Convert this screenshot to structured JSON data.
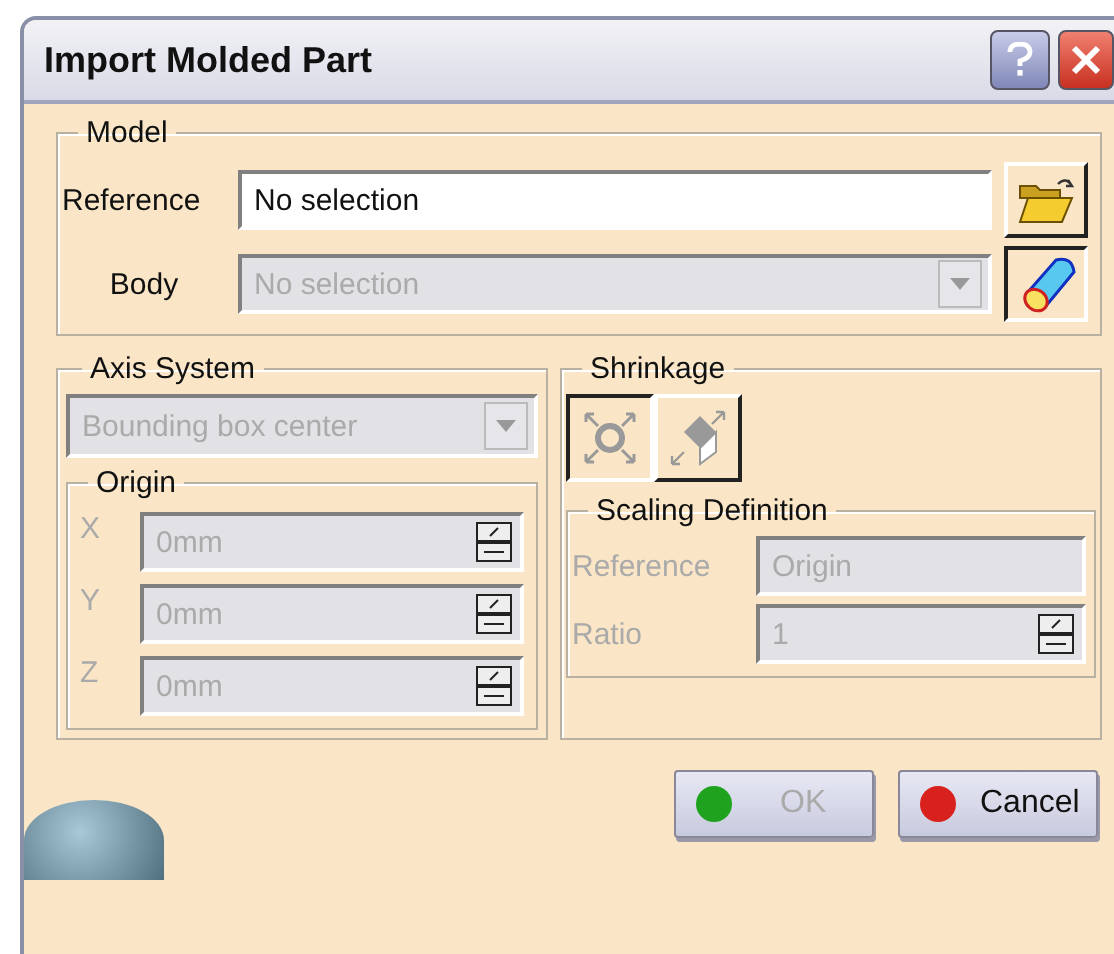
{
  "window": {
    "title": "Import Molded Part"
  },
  "model": {
    "title": "Model",
    "reference": {
      "label": "Reference",
      "value": "No selection"
    },
    "body": {
      "label": "Body",
      "value": "No selection",
      "disabled": true
    }
  },
  "axis_system": {
    "title": "Axis System",
    "value": "Bounding box center",
    "disabled": true,
    "origin": {
      "title": "Origin",
      "coords": [
        {
          "label": "X",
          "value": "0mm",
          "disabled": true
        },
        {
          "label": "Y",
          "value": "0mm",
          "disabled": true
        },
        {
          "label": "Z",
          "value": "0mm",
          "disabled": true
        }
      ]
    }
  },
  "shrinkage": {
    "title": "Shrinkage",
    "modes": [
      {
        "kind": "uniform",
        "selected": true
      },
      {
        "kind": "affinity",
        "selected": false
      }
    ],
    "scaling": {
      "title": "Scaling Definition",
      "reference": {
        "label": "Reference",
        "value": "Origin",
        "disabled": true
      },
      "ratio": {
        "label": "Ratio",
        "value": "1",
        "disabled": true
      }
    }
  },
  "buttons": [
    {
      "kind": "ok",
      "label": "OK",
      "disabled": true
    },
    {
      "kind": "cancel",
      "label": "Cancel",
      "disabled": false
    }
  ]
}
